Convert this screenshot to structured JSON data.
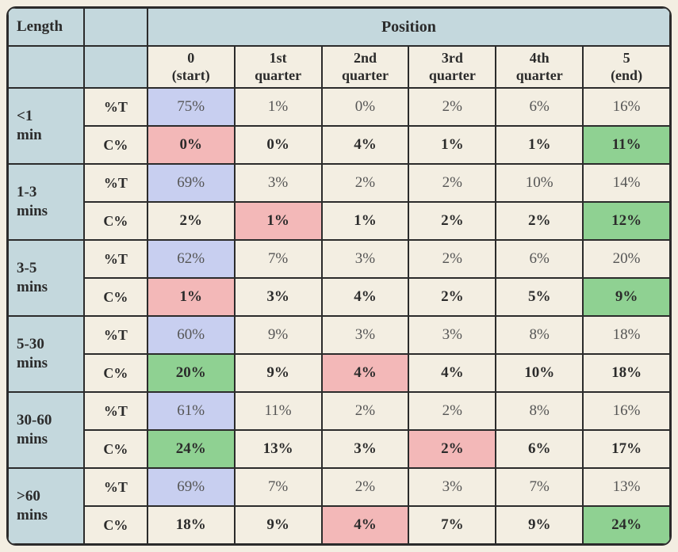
{
  "headers": {
    "length": "Length",
    "position": "Position",
    "columns": [
      "0\n(start)",
      "1st\nquarter",
      "2nd\nquarter",
      "3rd\nquarter",
      "4th\nquarter",
      "5\n(end)"
    ]
  },
  "metric_labels": {
    "pctT": "%T",
    "Cpct": "C%"
  },
  "chart_data": {
    "type": "table",
    "row_groups": [
      {
        "length": "<1\nmin",
        "rows": [
          {
            "metric": "pctT",
            "cells": [
              {
                "v": "75%",
                "c": "blue"
              },
              {
                "v": "1%",
                "c": ""
              },
              {
                "v": "0%",
                "c": ""
              },
              {
                "v": "2%",
                "c": ""
              },
              {
                "v": "6%",
                "c": ""
              },
              {
                "v": "16%",
                "c": ""
              }
            ]
          },
          {
            "metric": "Cpct",
            "cells": [
              {
                "v": "0%",
                "c": "pink bold"
              },
              {
                "v": "0%",
                "c": "bold"
              },
              {
                "v": "4%",
                "c": "bold"
              },
              {
                "v": "1%",
                "c": "bold"
              },
              {
                "v": "1%",
                "c": "bold"
              },
              {
                "v": "11%",
                "c": "green bold"
              }
            ]
          }
        ]
      },
      {
        "length": "1-3\nmins",
        "rows": [
          {
            "metric": "pctT",
            "cells": [
              {
                "v": "69%",
                "c": "blue"
              },
              {
                "v": "3%",
                "c": ""
              },
              {
                "v": "2%",
                "c": ""
              },
              {
                "v": "2%",
                "c": ""
              },
              {
                "v": "10%",
                "c": ""
              },
              {
                "v": "14%",
                "c": ""
              }
            ]
          },
          {
            "metric": "Cpct",
            "cells": [
              {
                "v": "2%",
                "c": "bold"
              },
              {
                "v": "1%",
                "c": "pink bold"
              },
              {
                "v": "1%",
                "c": "bold"
              },
              {
                "v": "2%",
                "c": "bold"
              },
              {
                "v": "2%",
                "c": "bold"
              },
              {
                "v": "12%",
                "c": "green bold"
              }
            ]
          }
        ]
      },
      {
        "length": "3-5\nmins",
        "rows": [
          {
            "metric": "pctT",
            "cells": [
              {
                "v": "62%",
                "c": "blue"
              },
              {
                "v": "7%",
                "c": ""
              },
              {
                "v": "3%",
                "c": ""
              },
              {
                "v": "2%",
                "c": ""
              },
              {
                "v": "6%",
                "c": ""
              },
              {
                "v": "20%",
                "c": ""
              }
            ]
          },
          {
            "metric": "Cpct",
            "cells": [
              {
                "v": "1%",
                "c": "pink bold"
              },
              {
                "v": "3%",
                "c": "bold"
              },
              {
                "v": "4%",
                "c": "bold"
              },
              {
                "v": "2%",
                "c": "bold"
              },
              {
                "v": "5%",
                "c": "bold"
              },
              {
                "v": "9%",
                "c": "green bold"
              }
            ]
          }
        ]
      },
      {
        "length": "5-30\nmins",
        "rows": [
          {
            "metric": "pctT",
            "cells": [
              {
                "v": "60%",
                "c": "blue"
              },
              {
                "v": "9%",
                "c": ""
              },
              {
                "v": "3%",
                "c": ""
              },
              {
                "v": "3%",
                "c": ""
              },
              {
                "v": "8%",
                "c": ""
              },
              {
                "v": "18%",
                "c": ""
              }
            ]
          },
          {
            "metric": "Cpct",
            "cells": [
              {
                "v": "20%",
                "c": "green bold"
              },
              {
                "v": "9%",
                "c": "bold"
              },
              {
                "v": "4%",
                "c": "pink bold"
              },
              {
                "v": "4%",
                "c": "bold"
              },
              {
                "v": "10%",
                "c": "bold"
              },
              {
                "v": "18%",
                "c": "bold"
              }
            ]
          }
        ]
      },
      {
        "length": "30-60\nmins",
        "rows": [
          {
            "metric": "pctT",
            "cells": [
              {
                "v": "61%",
                "c": "blue"
              },
              {
                "v": "11%",
                "c": ""
              },
              {
                "v": "2%",
                "c": ""
              },
              {
                "v": "2%",
                "c": ""
              },
              {
                "v": "8%",
                "c": ""
              },
              {
                "v": "16%",
                "c": ""
              }
            ]
          },
          {
            "metric": "Cpct",
            "cells": [
              {
                "v": "24%",
                "c": "green bold"
              },
              {
                "v": "13%",
                "c": "bold"
              },
              {
                "v": "3%",
                "c": "bold"
              },
              {
                "v": "2%",
                "c": "pink bold"
              },
              {
                "v": "6%",
                "c": "bold"
              },
              {
                "v": "17%",
                "c": "bold"
              }
            ]
          }
        ]
      },
      {
        "length": ">60\nmins",
        "rows": [
          {
            "metric": "pctT",
            "cells": [
              {
                "v": "69%",
                "c": "blue"
              },
              {
                "v": "7%",
                "c": ""
              },
              {
                "v": "2%",
                "c": ""
              },
              {
                "v": "3%",
                "c": ""
              },
              {
                "v": "7%",
                "c": ""
              },
              {
                "v": "13%",
                "c": ""
              }
            ]
          },
          {
            "metric": "Cpct",
            "cells": [
              {
                "v": "18%",
                "c": "bold"
              },
              {
                "v": "9%",
                "c": "bold"
              },
              {
                "v": "4%",
                "c": "pink bold"
              },
              {
                "v": "7%",
                "c": "bold"
              },
              {
                "v": "9%",
                "c": "bold"
              },
              {
                "v": "24%",
                "c": "green bold"
              }
            ]
          }
        ]
      }
    ]
  }
}
